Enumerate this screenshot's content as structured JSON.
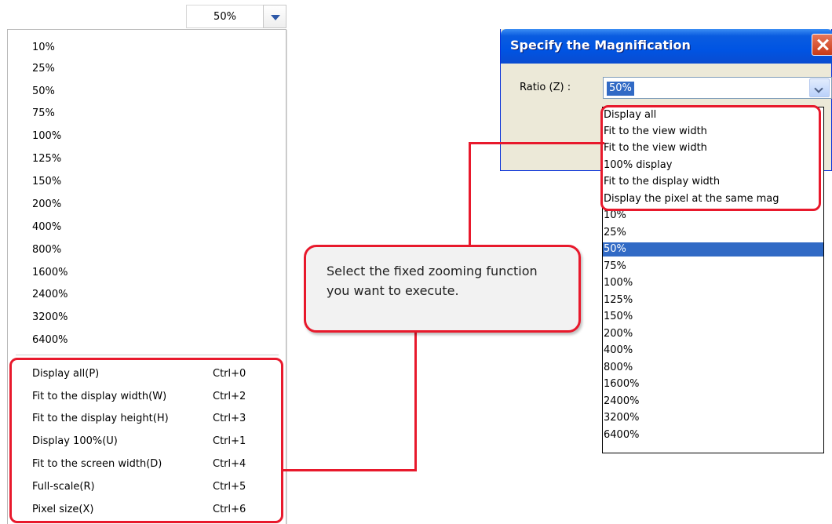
{
  "zoom_combo": {
    "value": "50%"
  },
  "zoom_menu": {
    "percentages": [
      "10%",
      "25%",
      "50%",
      "75%",
      "100%",
      "125%",
      "150%",
      "200%",
      "400%",
      "800%",
      "1600%",
      "2400%",
      "3200%",
      "6400%"
    ],
    "commands": [
      {
        "label": "Display all(P)",
        "shortcut": "Ctrl+0"
      },
      {
        "label": "Fit to the display width(W)",
        "shortcut": "Ctrl+2"
      },
      {
        "label": "Fit to the display height(H)",
        "shortcut": "Ctrl+3"
      },
      {
        "label": "Display 100%(U)",
        "shortcut": "Ctrl+1"
      },
      {
        "label": "Fit to the screen width(D)",
        "shortcut": "Ctrl+4"
      },
      {
        "label": "Full-scale(R)",
        "shortcut": "Ctrl+5"
      },
      {
        "label": "Pixel size(X)",
        "shortcut": "Ctrl+6"
      }
    ]
  },
  "dialog": {
    "title": "Specify the Magnification",
    "ratio_label": "Ratio (Z) :",
    "ratio_value": "50%",
    "options": [
      "Display all",
      "Fit to the view width",
      "Fit to the view width",
      "100% display",
      "Fit to the display width",
      "Display the pixel at the same mag",
      "10%",
      "25%",
      "50%",
      "75%",
      "100%",
      "125%",
      "150%",
      "200%",
      "400%",
      "800%",
      "1600%",
      "2400%",
      "3200%",
      "6400%"
    ],
    "selected_option": "50%"
  },
  "callout": {
    "text": "Select the fixed zooming function you want to execute."
  },
  "colors": {
    "highlight": "#e8192c",
    "title_bar": "#0054e3",
    "selection": "#316ac5"
  }
}
